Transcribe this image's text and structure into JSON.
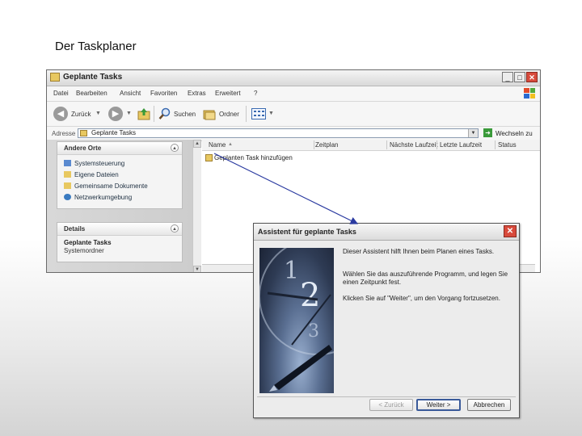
{
  "slide": {
    "title": "Der Taskplaner"
  },
  "explorer": {
    "title": "Geplante Tasks",
    "window_buttons": [
      "_",
      "□",
      "✕"
    ],
    "menu": [
      "Datei",
      "Bearbeiten",
      "Ansicht",
      "Favoriten",
      "Extras",
      "Erweitert",
      "?"
    ],
    "toolbar": {
      "back": "Zurück",
      "search": "Suchen",
      "folders": "Ordner"
    },
    "address": {
      "label": "Adresse",
      "value": "Geplante Tasks",
      "go": "Wechseln zu"
    },
    "taskpane": {
      "other_places": {
        "heading": "Andere Orte",
        "items": [
          "Systemsteuerung",
          "Eigene Dateien",
          "Gemeinsame Dokumente",
          "Netzwerkumgebung"
        ]
      },
      "details": {
        "heading": "Details",
        "name": "Geplante Tasks",
        "subtitle": "Systemordner"
      }
    },
    "columns": [
      "Name",
      "Zeitplan",
      "Nächste Laufzeit",
      "Letzte Laufzeit",
      "Status"
    ],
    "rows": [
      "Geplanten Task hinzufügen"
    ]
  },
  "wizard": {
    "title": "Assistent für geplante Tasks",
    "paragraphs": [
      "Dieser Assistent hilft Ihnen beim Planen eines Tasks.",
      "Wählen Sie das auszuführende Programm, und legen Sie einen Zeitpunkt fest.",
      "Klicken Sie auf \"Weiter\", um den Vorgang fortzusetzen."
    ],
    "buttons": {
      "back": "< Zurück",
      "next": "Weiter >",
      "cancel": "Abbrechen"
    }
  }
}
